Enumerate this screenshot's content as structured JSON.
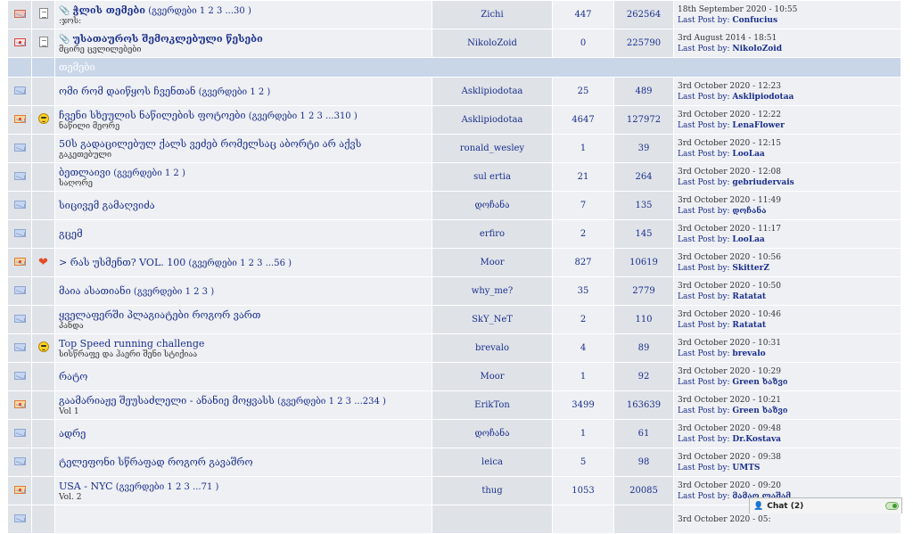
{
  "pinned": [
    {
      "title": "ჭლის თემები",
      "pages_label": "(გვერდები",
      "pages": "1 2 3 ...30",
      "pages_close": ")",
      "subtitle": ":ჯოს:",
      "starter": "Zichi",
      "replies": "447",
      "views": "262564",
      "last_date": "18th September 2020 - 10:55",
      "last_by_label": "Last Post by:",
      "last_by": "Confucius"
    },
    {
      "title": "უსათაუროს შემოკლებული წესები",
      "subtitle": "მცირე ცვლილებები",
      "starter": "NikoloZoid",
      "replies": "0",
      "views": "225790",
      "last_date": "3rd August 2014 - 18:51",
      "last_by_label": "Last Post by:",
      "last_by": "NikoloZoid"
    }
  ],
  "section": {
    "title": "თემები"
  },
  "topics": [
    {
      "title": "ომი რომ დაიწყოს ჩვენთან",
      "pages_label": "(გვერდები",
      "pages": "1 2",
      "pages_close": ")",
      "starter": "Asklipiodotaa",
      "replies": "25",
      "views": "489",
      "last_date": "3rd October 2020 - 12:23",
      "last_by_label": "Last Post by:",
      "last_by": "Asklipiodotaa"
    },
    {
      "title": "ჩვენი სხეულის ნაწილების ფოტოები",
      "pages_label": "(გვერდები",
      "pages": "1 2 3 ...310",
      "pages_close": ")",
      "subtitle": "ნაწილი მეორე",
      "starter": "Asklipiodotaa",
      "replies": "4647",
      "views": "127972",
      "last_date": "3rd October 2020 - 12:22",
      "last_by_label": "Last Post by:",
      "last_by": "LenaFlower"
    },
    {
      "title": "50ს გადაცილებულ ქალს ვეძებ რომელსაც აბორტი არ აქვს",
      "subtitle": "გაკეთებული",
      "starter": "ronald_wesley",
      "replies": "1",
      "views": "39",
      "last_date": "3rd October 2020 - 12:15",
      "last_by_label": "Last Post by:",
      "last_by": "LooLaa"
    },
    {
      "title": "ბეთლაივი",
      "pages_label": "(გვერდები",
      "pages": "1 2",
      "pages_close": ")",
      "subtitle": "საღორე",
      "starter": "sul ertia",
      "replies": "21",
      "views": "264",
      "last_date": "3rd October 2020 - 12:08",
      "last_by_label": "Last Post by:",
      "last_by": "gebriudervais"
    },
    {
      "title": "სიცივემ გამაღვიძა",
      "starter": "დოჩანა",
      "replies": "7",
      "views": "135",
      "last_date": "3rd October 2020 - 11:49",
      "last_by_label": "Last Post by:",
      "last_by": "დოჩანა"
    },
    {
      "title": "გცემ",
      "starter": "erfiro",
      "replies": "2",
      "views": "145",
      "last_date": "3rd October 2020 - 11:17",
      "last_by_label": "Last Post by:",
      "last_by": "LooLaa"
    },
    {
      "title": "> რას უსმენთ? VOL. 100",
      "pages_label": "(გვერდები",
      "pages": "1 2 3 ...56",
      "pages_close": ")",
      "starter": "Moor",
      "replies": "827",
      "views": "10619",
      "last_date": "3rd October 2020 - 10:56",
      "last_by_label": "Last Post by:",
      "last_by": "SkitterZ"
    },
    {
      "title": "მაია ასათიანი",
      "pages_label": "(გვერდები",
      "pages": "1 2 3",
      "pages_close": ")",
      "starter": "why_me?",
      "replies": "35",
      "views": "2779",
      "last_date": "3rd October 2020 - 10:50",
      "last_by_label": "Last Post by:",
      "last_by": "Ratatat"
    },
    {
      "title": "ყველაფერში პლაგიატები როგორ ვართ",
      "subtitle": "პანდა",
      "starter": "SkY_NeT",
      "replies": "2",
      "views": "110",
      "last_date": "3rd October 2020 - 10:46",
      "last_by_label": "Last Post by:",
      "last_by": "Ratatat"
    },
    {
      "title": "Top Speed running challenge",
      "subtitle": "სისწრაფე და ჰაერი შენი სტიქიაა",
      "starter": "brevalo",
      "replies": "4",
      "views": "89",
      "last_date": "3rd October 2020 - 10:31",
      "last_by_label": "Last Post by:",
      "last_by": "brevalo"
    },
    {
      "title": "რატო",
      "starter": "Moor",
      "replies": "1",
      "views": "92",
      "last_date": "3rd October 2020 - 10:29",
      "last_by_label": "Last Post by:",
      "last_by": "Green ხაზვი"
    },
    {
      "title": "გაამარიაჟე შეუსაძლელი - ანანიე მოყვასს",
      "pages_label": "(გვერდები",
      "pages": "1 2 3 ...234",
      "pages_close": ")",
      "subtitle": "Vol 1",
      "starter": "ErikTon",
      "replies": "3499",
      "views": "163639",
      "last_date": "3rd October 2020 - 10:21",
      "last_by_label": "Last Post by:",
      "last_by": "Green ხაზვი"
    },
    {
      "title": "ადრე",
      "starter": "დოჩანა",
      "replies": "1",
      "views": "61",
      "last_date": "3rd October 2020 - 09:48",
      "last_by_label": "Last Post by:",
      "last_by": "Dr.Kostava"
    },
    {
      "title": "ტელეფონი სწრაფად როგორ გავაშრო",
      "starter": "leica",
      "replies": "5",
      "views": "98",
      "last_date": "3rd October 2020 - 09:38",
      "last_by_label": "Last Post by:",
      "last_by": "UMTS"
    },
    {
      "title": "USA - NYC",
      "pages_label": "(გვერდები",
      "pages": "1 2 3 ...71",
      "pages_close": ")",
      "subtitle": "Vol. 2",
      "starter": "thug",
      "replies": "1053",
      "views": "20085",
      "last_date": "3rd October 2020 - 09:20",
      "last_by_label": "Last Post by:",
      "last_by": "მამაო ლაშამ"
    },
    {
      "last_date": "3rd October 2020 - 05:"
    }
  ],
  "icons": {
    "pinned": [
      "envelope-sticky-icon",
      "envelope-pinned-icon"
    ],
    "topics": [
      "envelope-icon",
      "envelope-hot-icon",
      "envelope-icon",
      "envelope-icon",
      "envelope-icon",
      "envelope-icon",
      "envelope-hot-icon",
      "envelope-icon",
      "envelope-icon",
      "envelope-icon",
      "envelope-icon",
      "envelope-hot-icon",
      "envelope-icon",
      "envelope-icon",
      "envelope-hot-icon",
      "envelope-icon"
    ],
    "moods": {
      "1": "cool-smiley-icon",
      "6": "heart-icon",
      "9": "cool-smiley-icon"
    }
  },
  "chat": {
    "label": "Chat (2)"
  },
  "colors": {
    "link": "#1b2f8c",
    "section_bg": "#c8d6e8",
    "row_dark": "#dfe3e8",
    "row_light": "#eef0f3"
  }
}
